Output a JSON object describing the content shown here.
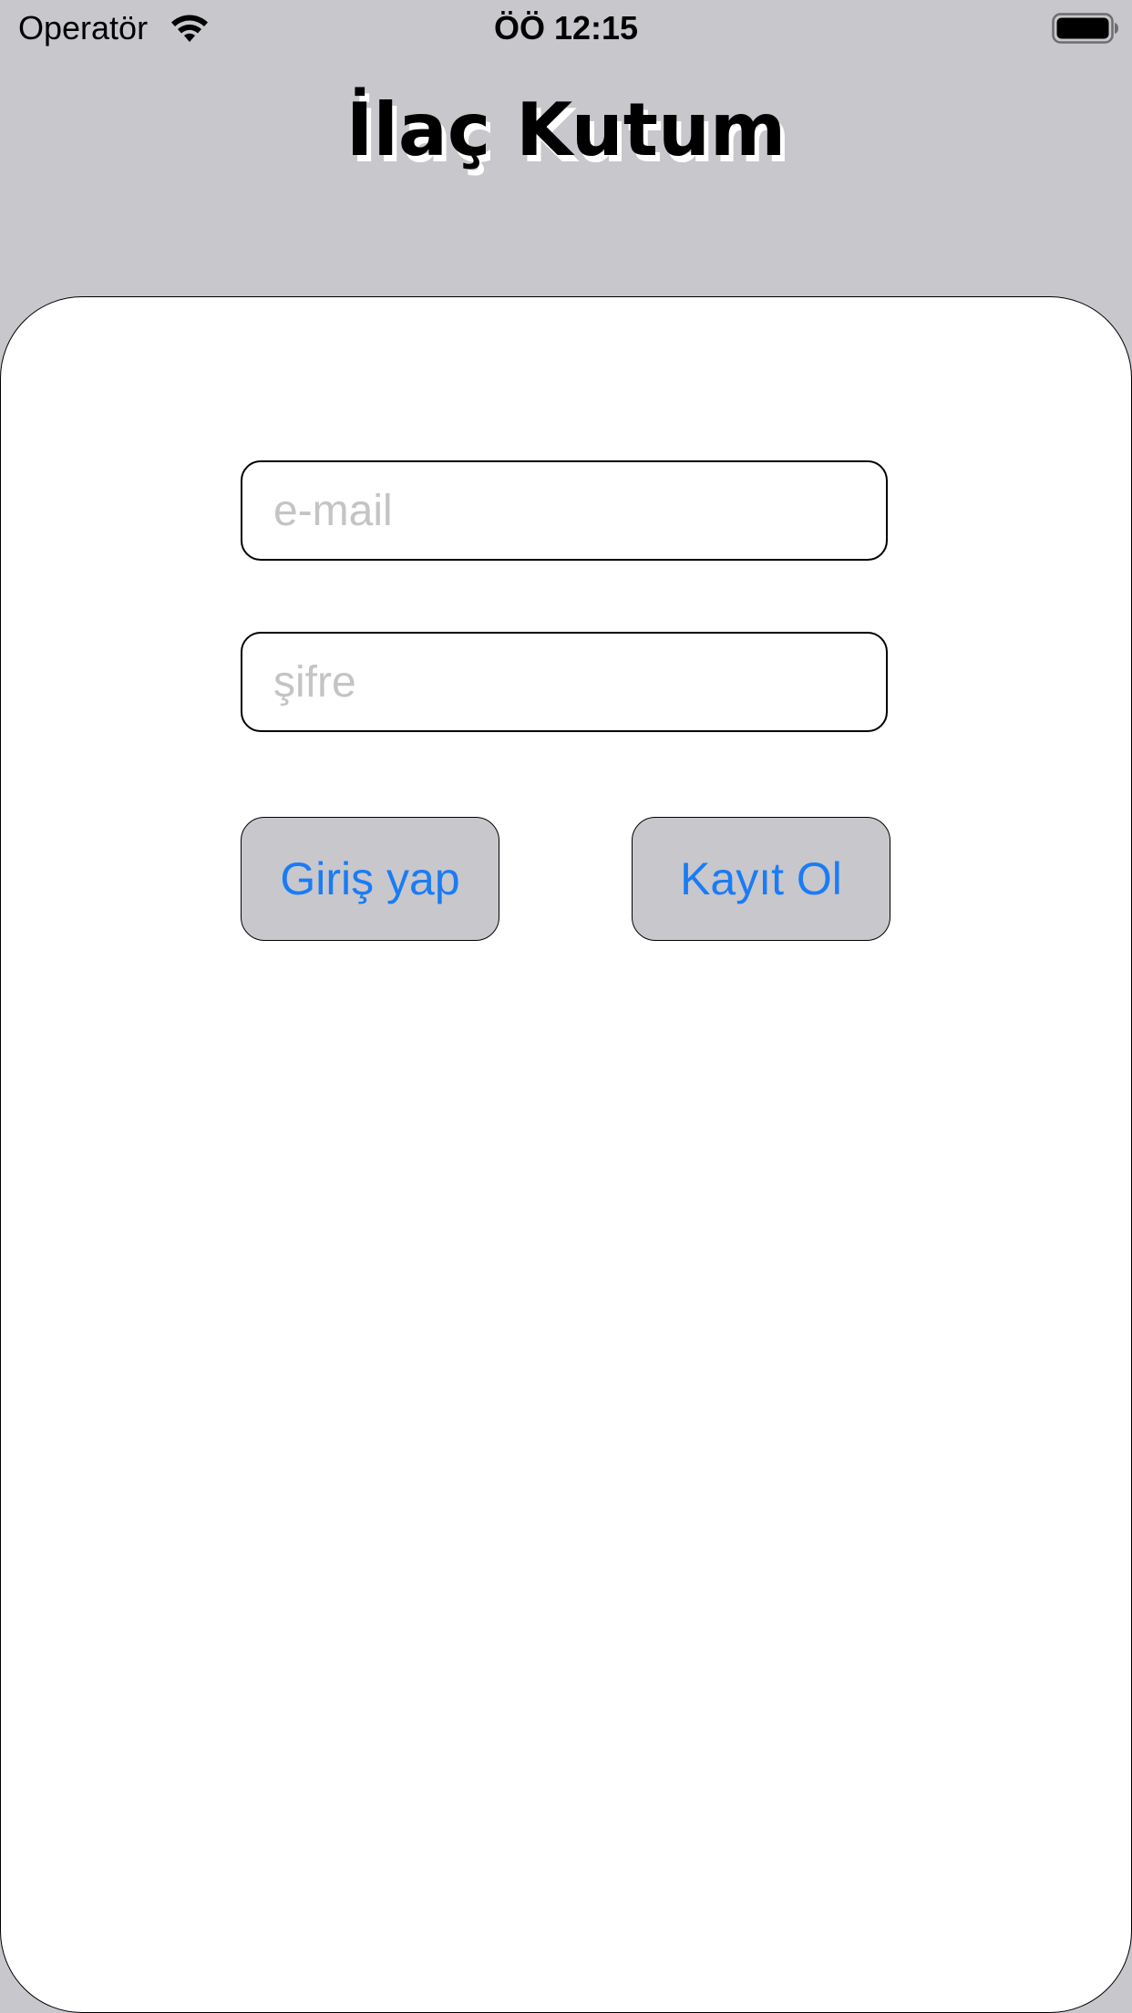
{
  "status_bar": {
    "carrier": "Operatör",
    "time": "ÖÖ 12:15",
    "wifi_icon": "wifi-icon",
    "battery_icon": "battery-full-icon"
  },
  "app": {
    "title": "İlaç Kutum"
  },
  "form": {
    "email_placeholder": "e-mail",
    "email_value": "",
    "password_placeholder": "şifre",
    "password_value": ""
  },
  "buttons": {
    "login_label": "Giriş yap",
    "register_label": "Kayıt Ol"
  },
  "colors": {
    "background": "#c8c7cc",
    "card": "#ffffff",
    "button_text": "#1a7cf5",
    "placeholder": "#c4c4c6"
  }
}
